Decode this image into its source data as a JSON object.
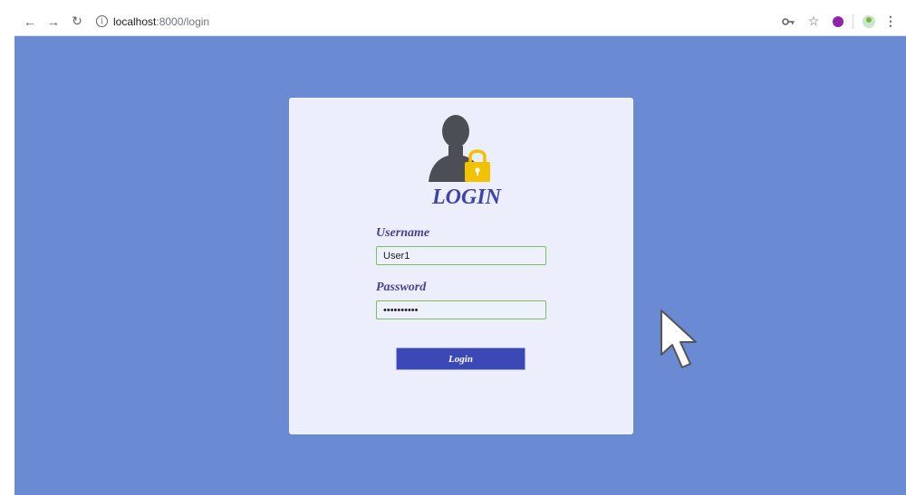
{
  "browser": {
    "url_host": "localhost",
    "url_path": ":8000/login"
  },
  "login": {
    "title": "LOGIN",
    "username_label": "Username",
    "username_value": "User1",
    "password_label": "Password",
    "password_value": "••••••••••",
    "button_label": "Login"
  },
  "colors": {
    "page_background": "#6a8bd3",
    "card_background": "#edeefb",
    "accent": "#3d44a8",
    "input_border": "#7bbf5b",
    "lock": "#f2c100"
  }
}
